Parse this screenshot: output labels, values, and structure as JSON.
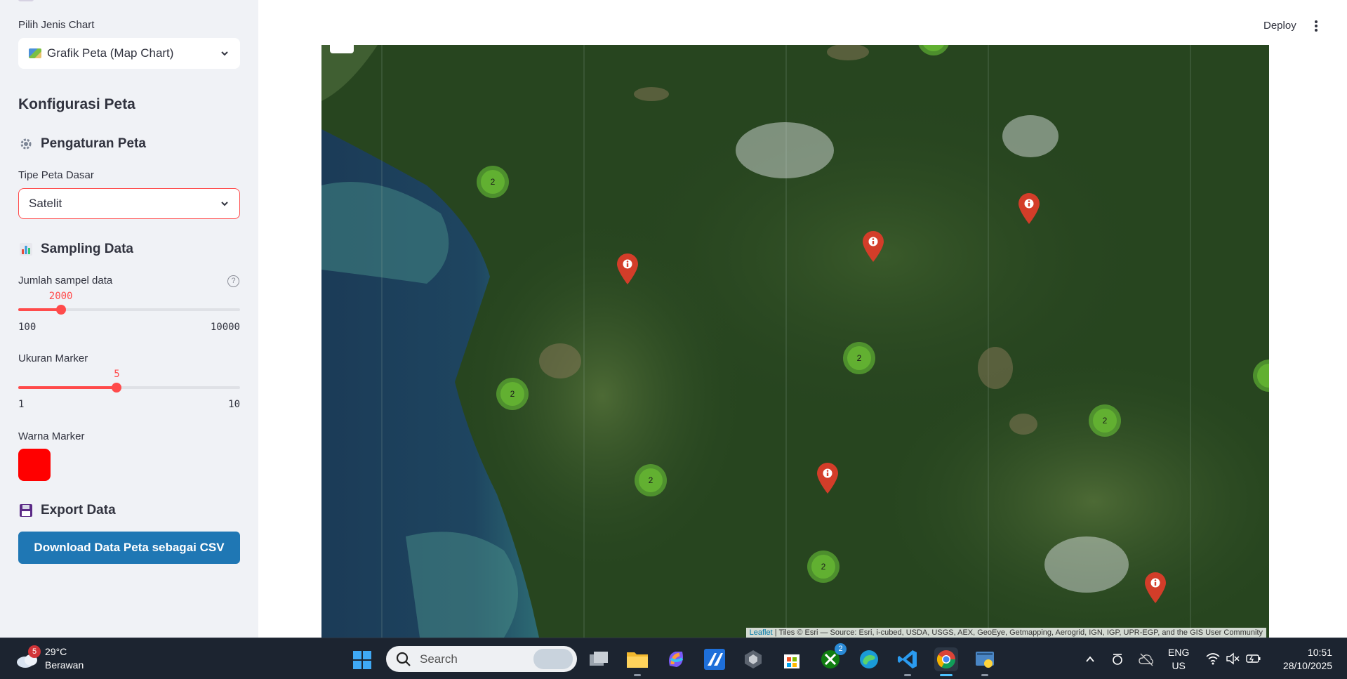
{
  "sidebar": {
    "chart_type_label": "Pilih Jenis Chart",
    "chart_type_value": "Grafik Peta (Map Chart)",
    "config_title": "Konfigurasi Peta",
    "map_settings_title": "Pengaturan Peta",
    "base_map_label": "Tipe Peta Dasar",
    "base_map_value": "Satelit",
    "sampling_title": "Sampling Data",
    "sample_label": "Jumlah sampel data",
    "sample_value": "2000",
    "sample_fraction": 0.1919,
    "sample_min": "100",
    "sample_max": "10000",
    "marker_size_label": "Ukuran Marker",
    "marker_size_value": "5",
    "marker_size_fraction": 0.4444,
    "marker_size_min": "1",
    "marker_size_max": "10",
    "marker_color_label": "Warna Marker",
    "marker_color": "#ff0000",
    "export_title": "Export Data",
    "download_button": "Download Data Peta sebagai CSV",
    "accent_color": "#ff4b4b"
  },
  "header": {
    "deploy_label": "Deploy",
    "menu_icon": "kebab-menu-icon"
  },
  "map": {
    "cluster_count": "2",
    "attribution_leaflet": "Leaflet",
    "attribution_text": "| Tiles © Esri — Source: Esri, i-cubed, USDA, USGS, AEX, GeoEye, Getmapping, Aerogrid, IGN, IGP, UPR-EGP, and the GIS User Community"
  },
  "taskbar": {
    "weather_badge": "5",
    "temperature": "29°C",
    "condition": "Berawan",
    "search_placeholder": "Search",
    "xbox_badge": "2",
    "lang_line1": "ENG",
    "lang_line2": "US",
    "time": "10:51",
    "date": "28/10/2025"
  }
}
